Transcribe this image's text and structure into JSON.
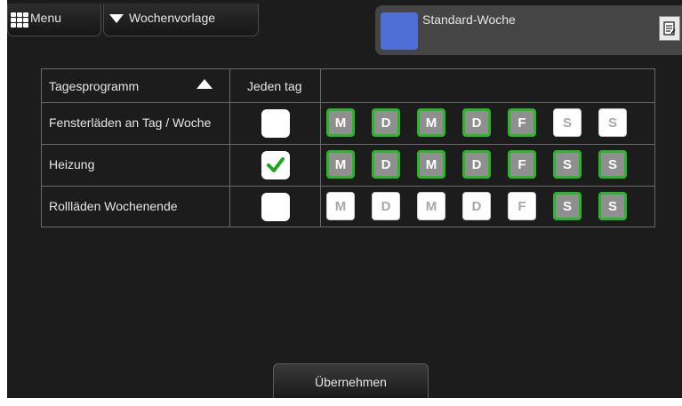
{
  "topbar": {
    "menu_label": "Menu",
    "vorlage_label": "Wochenvorlage",
    "standard_label": "Standard-Woche",
    "standard_color": "#4f6fd6"
  },
  "table": {
    "headers": {
      "program": "Tagesprogramm",
      "every_day": "Jeden tag"
    },
    "sort_indicator": "sort-ascending-icon",
    "rows": [
      {
        "name": "Fensterläden an Tag / Woche",
        "every_day": false,
        "days": [
          {
            "label": "M",
            "on": true
          },
          {
            "label": "D",
            "on": true
          },
          {
            "label": "M",
            "on": true
          },
          {
            "label": "D",
            "on": true
          },
          {
            "label": "F",
            "on": true
          },
          {
            "label": "S",
            "on": false
          },
          {
            "label": "S",
            "on": false
          }
        ]
      },
      {
        "name": "Heizung",
        "every_day": true,
        "days": [
          {
            "label": "M",
            "on": true
          },
          {
            "label": "D",
            "on": true
          },
          {
            "label": "M",
            "on": true
          },
          {
            "label": "D",
            "on": true
          },
          {
            "label": "F",
            "on": true
          },
          {
            "label": "S",
            "on": true
          },
          {
            "label": "S",
            "on": true
          }
        ]
      },
      {
        "name": "Rollläden Wochenende",
        "every_day": false,
        "days": [
          {
            "label": "M",
            "on": false
          },
          {
            "label": "D",
            "on": false
          },
          {
            "label": "M",
            "on": false
          },
          {
            "label": "D",
            "on": false
          },
          {
            "label": "F",
            "on": false
          },
          {
            "label": "S",
            "on": true
          },
          {
            "label": "S",
            "on": true
          }
        ]
      }
    ]
  },
  "footer": {
    "apply_label": "Übernehmen"
  },
  "colors": {
    "active_border": "#2bb52b",
    "active_fill": "#8f8f8f",
    "check": "#1fa51f"
  }
}
